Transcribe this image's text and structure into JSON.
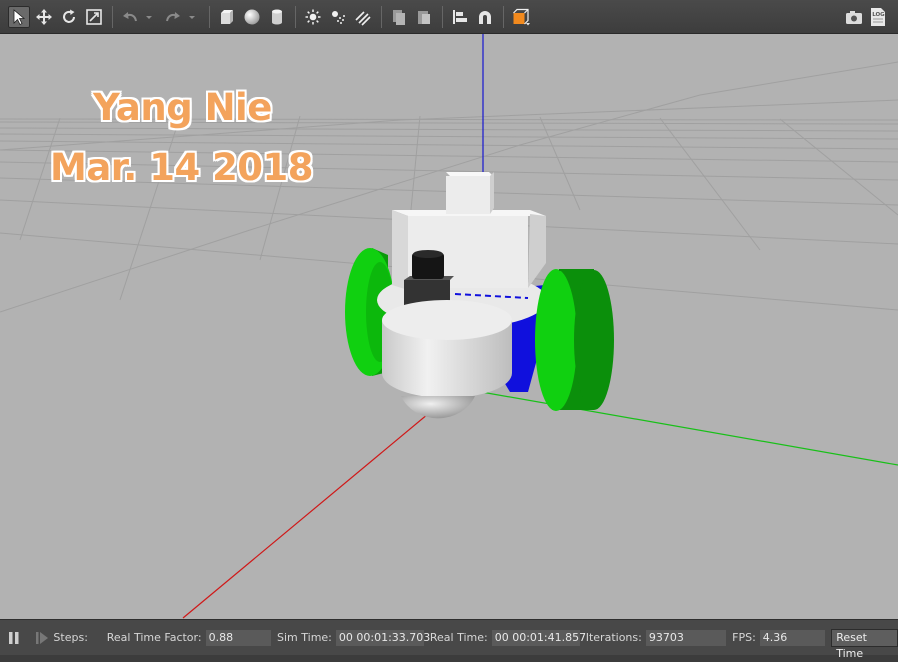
{
  "toolbar": {
    "tools": [
      {
        "icon": "select-arrow-icon",
        "active": true
      },
      {
        "icon": "translate-icon"
      },
      {
        "icon": "rotate-icon"
      },
      {
        "icon": "scale-icon"
      },
      {
        "icon": "undo-icon"
      },
      {
        "icon": "undo-history-dropdown-icon"
      },
      {
        "icon": "redo-icon"
      },
      {
        "icon": "redo-history-dropdown-icon"
      },
      {
        "icon": "box-shape-icon"
      },
      {
        "icon": "sphere-shape-icon"
      },
      {
        "icon": "cylinder-shape-icon"
      },
      {
        "icon": "point-light-icon"
      },
      {
        "icon": "spot-light-icon"
      },
      {
        "icon": "directional-light-icon"
      },
      {
        "icon": "copy-icon"
      },
      {
        "icon": "paste-icon"
      },
      {
        "icon": "align-icon"
      },
      {
        "icon": "snap-icon"
      },
      {
        "icon": "view-angle-icon"
      }
    ],
    "right_icons": [
      "screenshot-camera-icon",
      "log-icon"
    ],
    "log_label": "LOG"
  },
  "viewport": {
    "overlay_line1": "Yang Nie",
    "overlay_line2": "Mar. 14 2018",
    "colors": {
      "background": "#b2b2b2",
      "grid": "#9e9e9e",
      "axis_x": "#d01818",
      "axis_y": "#18c018",
      "axis_z": "#1818d0",
      "wheel": "#0fd40f",
      "body": "#e6e6e6",
      "overlay_text": "#f3a35c"
    }
  },
  "statusbar": {
    "steps_label": "Steps:",
    "rtf_label": "Real Time Factor:",
    "rtf_value": "0.88",
    "sim_time_label": "Sim Time:",
    "sim_time_value": "00 00:01:33.703",
    "real_time_label": "Real Time:",
    "real_time_value": "00 00:01:41.857",
    "iterations_label": "Iterations:",
    "iterations_value": "93703",
    "fps_label": "FPS:",
    "fps_value": "4.36",
    "reset_time_label": "Reset Time"
  }
}
